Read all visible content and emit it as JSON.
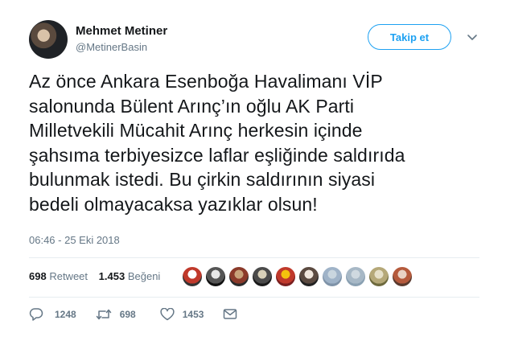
{
  "author": {
    "name": "Mehmet Metiner",
    "handle": "@MetinerBasin"
  },
  "header": {
    "follow_label": "Takip et"
  },
  "tweet": {
    "lines": [
      "Az önce Ankara Esenboğa Havalimanı VİP",
      "salonunda Bülent Arınç’ın oğlu AK Parti",
      "Milletvekili Mücahit Arınç herkesin içinde",
      "şahsıma terbiyesizce laflar eşliğinde saldırıda",
      "bulunmak istedi. Bu çirkin saldırının siyasi",
      "bedeli olmayacaksa yazıklar olsun!"
    ],
    "timestamp": "06:46 - 25 Eki 2018"
  },
  "stats": {
    "retweet_count": "698",
    "retweet_label": "Retweet",
    "like_count": "1.453",
    "like_label": "Beğeni"
  },
  "likers": [
    {
      "name": "liker-avatar-1",
      "colors": [
        "#ffffff",
        "#c0392b",
        "#333333"
      ]
    },
    {
      "name": "liker-avatar-2",
      "colors": [
        "#e8e8e8",
        "#555555",
        "#111111"
      ]
    },
    {
      "name": "liker-avatar-3",
      "colors": [
        "#c8a27a",
        "#8b3a2a",
        "#2b2b2b"
      ]
    },
    {
      "name": "liker-avatar-4",
      "colors": [
        "#d8d0b8",
        "#4a4a4a",
        "#1a1a1a"
      ]
    },
    {
      "name": "liker-avatar-5",
      "colors": [
        "#f4c20d",
        "#c0392b",
        "#7a1f1f"
      ]
    },
    {
      "name": "liker-avatar-6",
      "colors": [
        "#f0e6dc",
        "#5b4a40",
        "#222222"
      ]
    },
    {
      "name": "liker-avatar-7",
      "colors": [
        "#c9d6df",
        "#9fb3c8",
        "#7f93a8"
      ]
    },
    {
      "name": "liker-avatar-8",
      "colors": [
        "#cfd9e0",
        "#a7b8c6",
        "#8aa0b2"
      ]
    },
    {
      "name": "liker-avatar-9",
      "colors": [
        "#e6e0c8",
        "#b5a878",
        "#6e6a3e"
      ]
    },
    {
      "name": "liker-avatar-10",
      "colors": [
        "#e9d2c4",
        "#b55a3c",
        "#5a3a2e"
      ]
    }
  ],
  "actions": {
    "reply_count": "1248",
    "retweet_count": "698",
    "like_count": "1453"
  },
  "icons": {
    "reply": "reply-icon",
    "retweet": "retweet-icon",
    "like": "heart-icon",
    "dm": "envelope-icon",
    "menu": "chevron-down-icon"
  },
  "colors": {
    "accent": "#1da1f2",
    "text": "#14171a",
    "muted": "#657786",
    "border": "#e6ecf0"
  }
}
